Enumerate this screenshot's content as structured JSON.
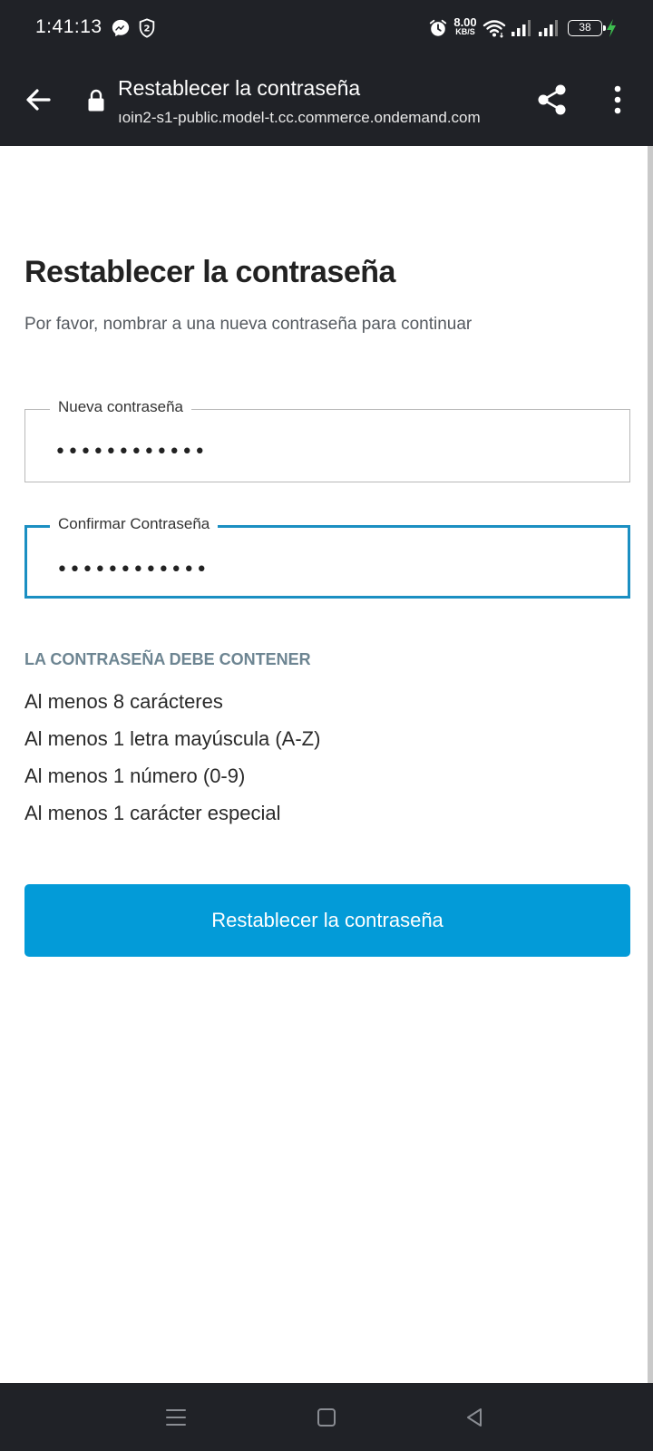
{
  "status_bar": {
    "time": "1:41:13",
    "net_speed_value": "8.00",
    "net_speed_unit": "KB/S",
    "battery_level": "38"
  },
  "browser": {
    "page_title": "Restablecer la contraseña",
    "url_display": "ıoin2-s1-public.model-t.cc.commerce.ondemand.com"
  },
  "page": {
    "heading": "Restablecer la contraseña",
    "subtitle": "Por favor, nombrar a una nueva contraseña para continuar",
    "new_password": {
      "label": "Nueva contraseña",
      "value": "••••••••••••"
    },
    "confirm_password": {
      "label": "Confirmar Contraseña",
      "value": "••••••••••••"
    },
    "requirements_heading": "LA CONTRASEÑA DEBE CONTENER",
    "requirements": [
      "Al menos 8 carácteres",
      "Al menos 1 letra mayúscula (A-Z)",
      "Al menos 1 número (0-9)",
      "Al menos 1 carácter especial"
    ],
    "submit_label": "Restablecer la contraseña"
  },
  "colors": {
    "dark_bar": "#202227",
    "accent": "#039bd8",
    "focus_border": "#1b8fc2",
    "requirements_heading": "#6d8592"
  }
}
